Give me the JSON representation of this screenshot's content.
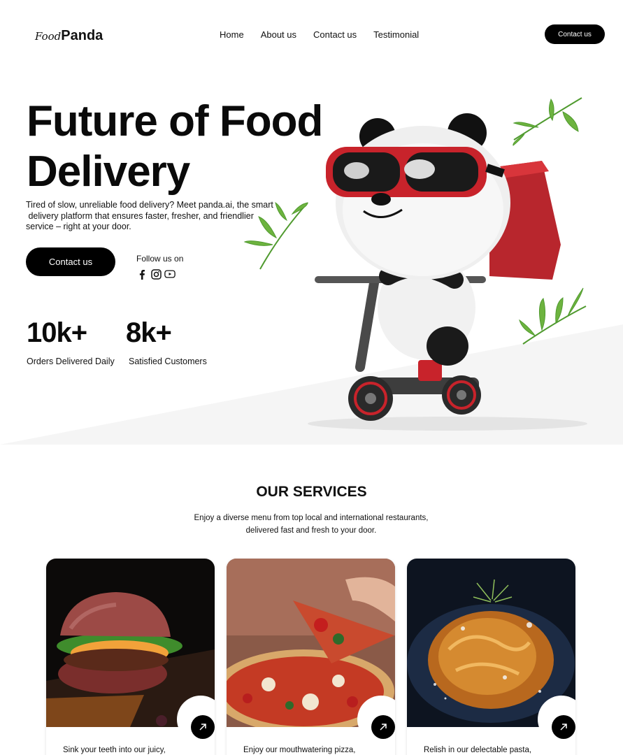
{
  "brand": {
    "prefix": "Food",
    "name": "Panda"
  },
  "nav": {
    "links": [
      "Home",
      "About us",
      "Contact us",
      "Testimonial"
    ],
    "cta": "Contact us"
  },
  "hero": {
    "title_line1": "Future of Food",
    "title_line2": "Delivery",
    "description_line1": "Tired of slow, unreliable food delivery? Meet panda.ai, the smart",
    "description_line2": " delivery platform that ensures faster, fresher, and friendlier",
    "description_line3": "service – right at your door.",
    "cta": "Contact us",
    "follow_label": "Follow us on",
    "socials": [
      "facebook-icon",
      "instagram-icon",
      "youtube-icon"
    ]
  },
  "stats": [
    {
      "value": "10k+",
      "label": "Orders Delivered Daily"
    },
    {
      "value": "8k+",
      "label": "Satisfied Customers"
    }
  ],
  "services": {
    "title": "OUR SERVICES",
    "subtitle_line1": "Enjoy a diverse menu from top local and international restaurants,",
    "subtitle_line2": "delivered fast and fresh to your door.",
    "cards": [
      {
        "image": "burger",
        "text": "Sink your teeth into our juicy,"
      },
      {
        "image": "pizza",
        "text": "Enjoy our mouthwatering pizza,"
      },
      {
        "image": "pasta",
        "text": "Relish in our delectable pasta,"
      }
    ]
  },
  "colors": {
    "primary": "#000000",
    "accent_red": "#c8232b",
    "leaf_green": "#4f9a2e"
  }
}
